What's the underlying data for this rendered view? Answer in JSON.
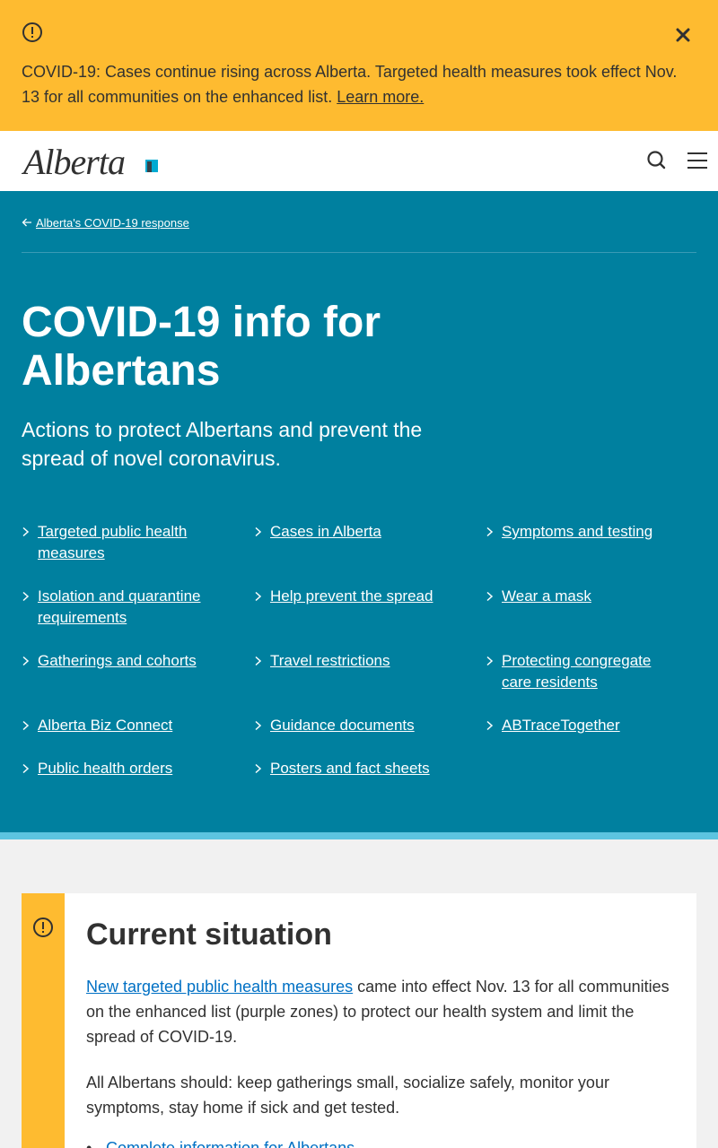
{
  "alert": {
    "icon": "exclamation-circle-icon",
    "close_icon": "close-icon",
    "text": "COVID-19: Cases continue rising across Alberta. Targeted health measures took effect Nov. 13 for all communities on the enhanced list. ",
    "link": "Learn more.",
    "bg_color": "#febb30"
  },
  "header": {
    "logo_text": "Alberta",
    "search_icon": "search-icon",
    "menu_icon": "hamburger-menu-icon"
  },
  "hero": {
    "breadcrumb": "Alberta's COVID-19 response",
    "title": "COVID-19 info for Albertans",
    "subtitle": "Actions to protect Albertans and prevent the spread of novel coronavirus.",
    "bg_color": "#00809f",
    "links": [
      [
        "Targeted public health measures",
        "Cases in Alberta",
        "Symptoms and testing"
      ],
      [
        "Isolation and quarantine requirements",
        "Help prevent the spread",
        "Wear a mask"
      ],
      [
        "Gatherings and cohorts",
        "Travel restrictions",
        "Protecting congregate care residents"
      ],
      [
        "Alberta Biz Connect",
        "Guidance documents",
        "ABTraceTogether"
      ],
      [
        "Public health orders",
        "Posters and fact sheets"
      ]
    ]
  },
  "situation": {
    "icon": "exclamation-circle-icon",
    "title": "Current situation",
    "p1_link": "New targeted public health measures",
    "p1_text": " came into effect Nov. 13 for all communities on the enhanced list (purple zones) to protect our health system and limit the spread of COVID-19.",
    "p2": "All Albertans should: keep gatherings small, socialize safely, monitor your symptoms, stay home if sick and get tested.",
    "list_item": "Complete information for Albertans"
  }
}
